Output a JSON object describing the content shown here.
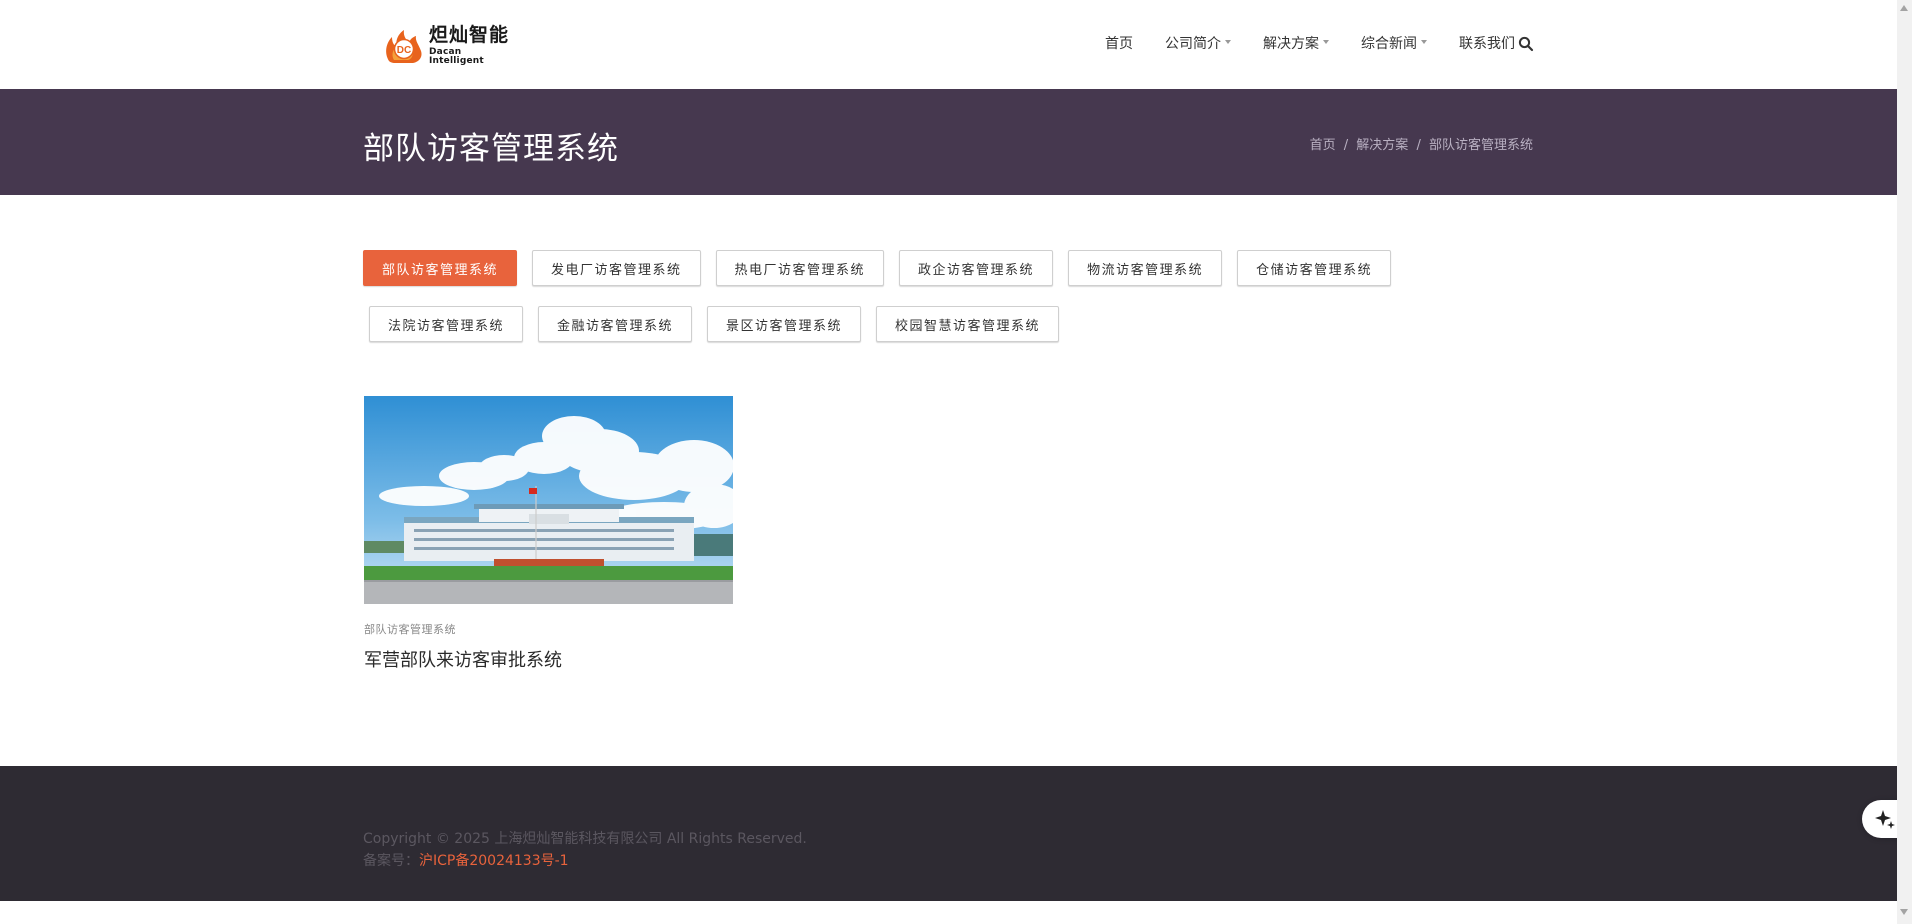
{
  "header": {
    "logo": {
      "cn": "炟灿智能",
      "en": "Dacan Intelligent",
      "mark_letters": "DC",
      "mark_color": "#e8631d"
    },
    "nav": [
      {
        "label": "首页",
        "dropdown": false
      },
      {
        "label": "公司简介",
        "dropdown": true
      },
      {
        "label": "解决方案",
        "dropdown": true
      },
      {
        "label": "综合新闻",
        "dropdown": true
      },
      {
        "label": "联系我们",
        "dropdown": false
      }
    ],
    "search_icon": "search-icon"
  },
  "titlebar": {
    "title": "部队访客管理系统",
    "breadcrumb": [
      "首页",
      "解决方案",
      "部队访客管理系统"
    ],
    "separator": "/",
    "background": "#46384f"
  },
  "filters": {
    "row1": [
      {
        "label": "部队访客管理系统",
        "active": true
      },
      {
        "label": "发电厂访客管理系统",
        "active": false
      },
      {
        "label": "热电厂访客管理系统",
        "active": false
      },
      {
        "label": "政企访客管理系统",
        "active": false
      },
      {
        "label": "物流访客管理系统",
        "active": false
      },
      {
        "label": "仓储访客管理系统",
        "active": false
      }
    ],
    "row2": [
      {
        "label": "法院访客管理系统",
        "active": false
      },
      {
        "label": "金融访客管理系统",
        "active": false
      },
      {
        "label": "景区访客管理系统",
        "active": false
      },
      {
        "label": "校园智慧访客管理系统",
        "active": false
      }
    ],
    "active_color": "#e8633c"
  },
  "card": {
    "category": "部队访客管理系统",
    "title": "军营部队来访客审批系统"
  },
  "footer": {
    "copyright": "Copyright © 2025 上海炟灿智能科技有限公司 All Rights Reserved.",
    "icp_label": "备案号：",
    "icp_link": "沪ICP备20024133号-1",
    "background": "#2e2b33"
  },
  "float_button_icon": "sparkle-icon"
}
